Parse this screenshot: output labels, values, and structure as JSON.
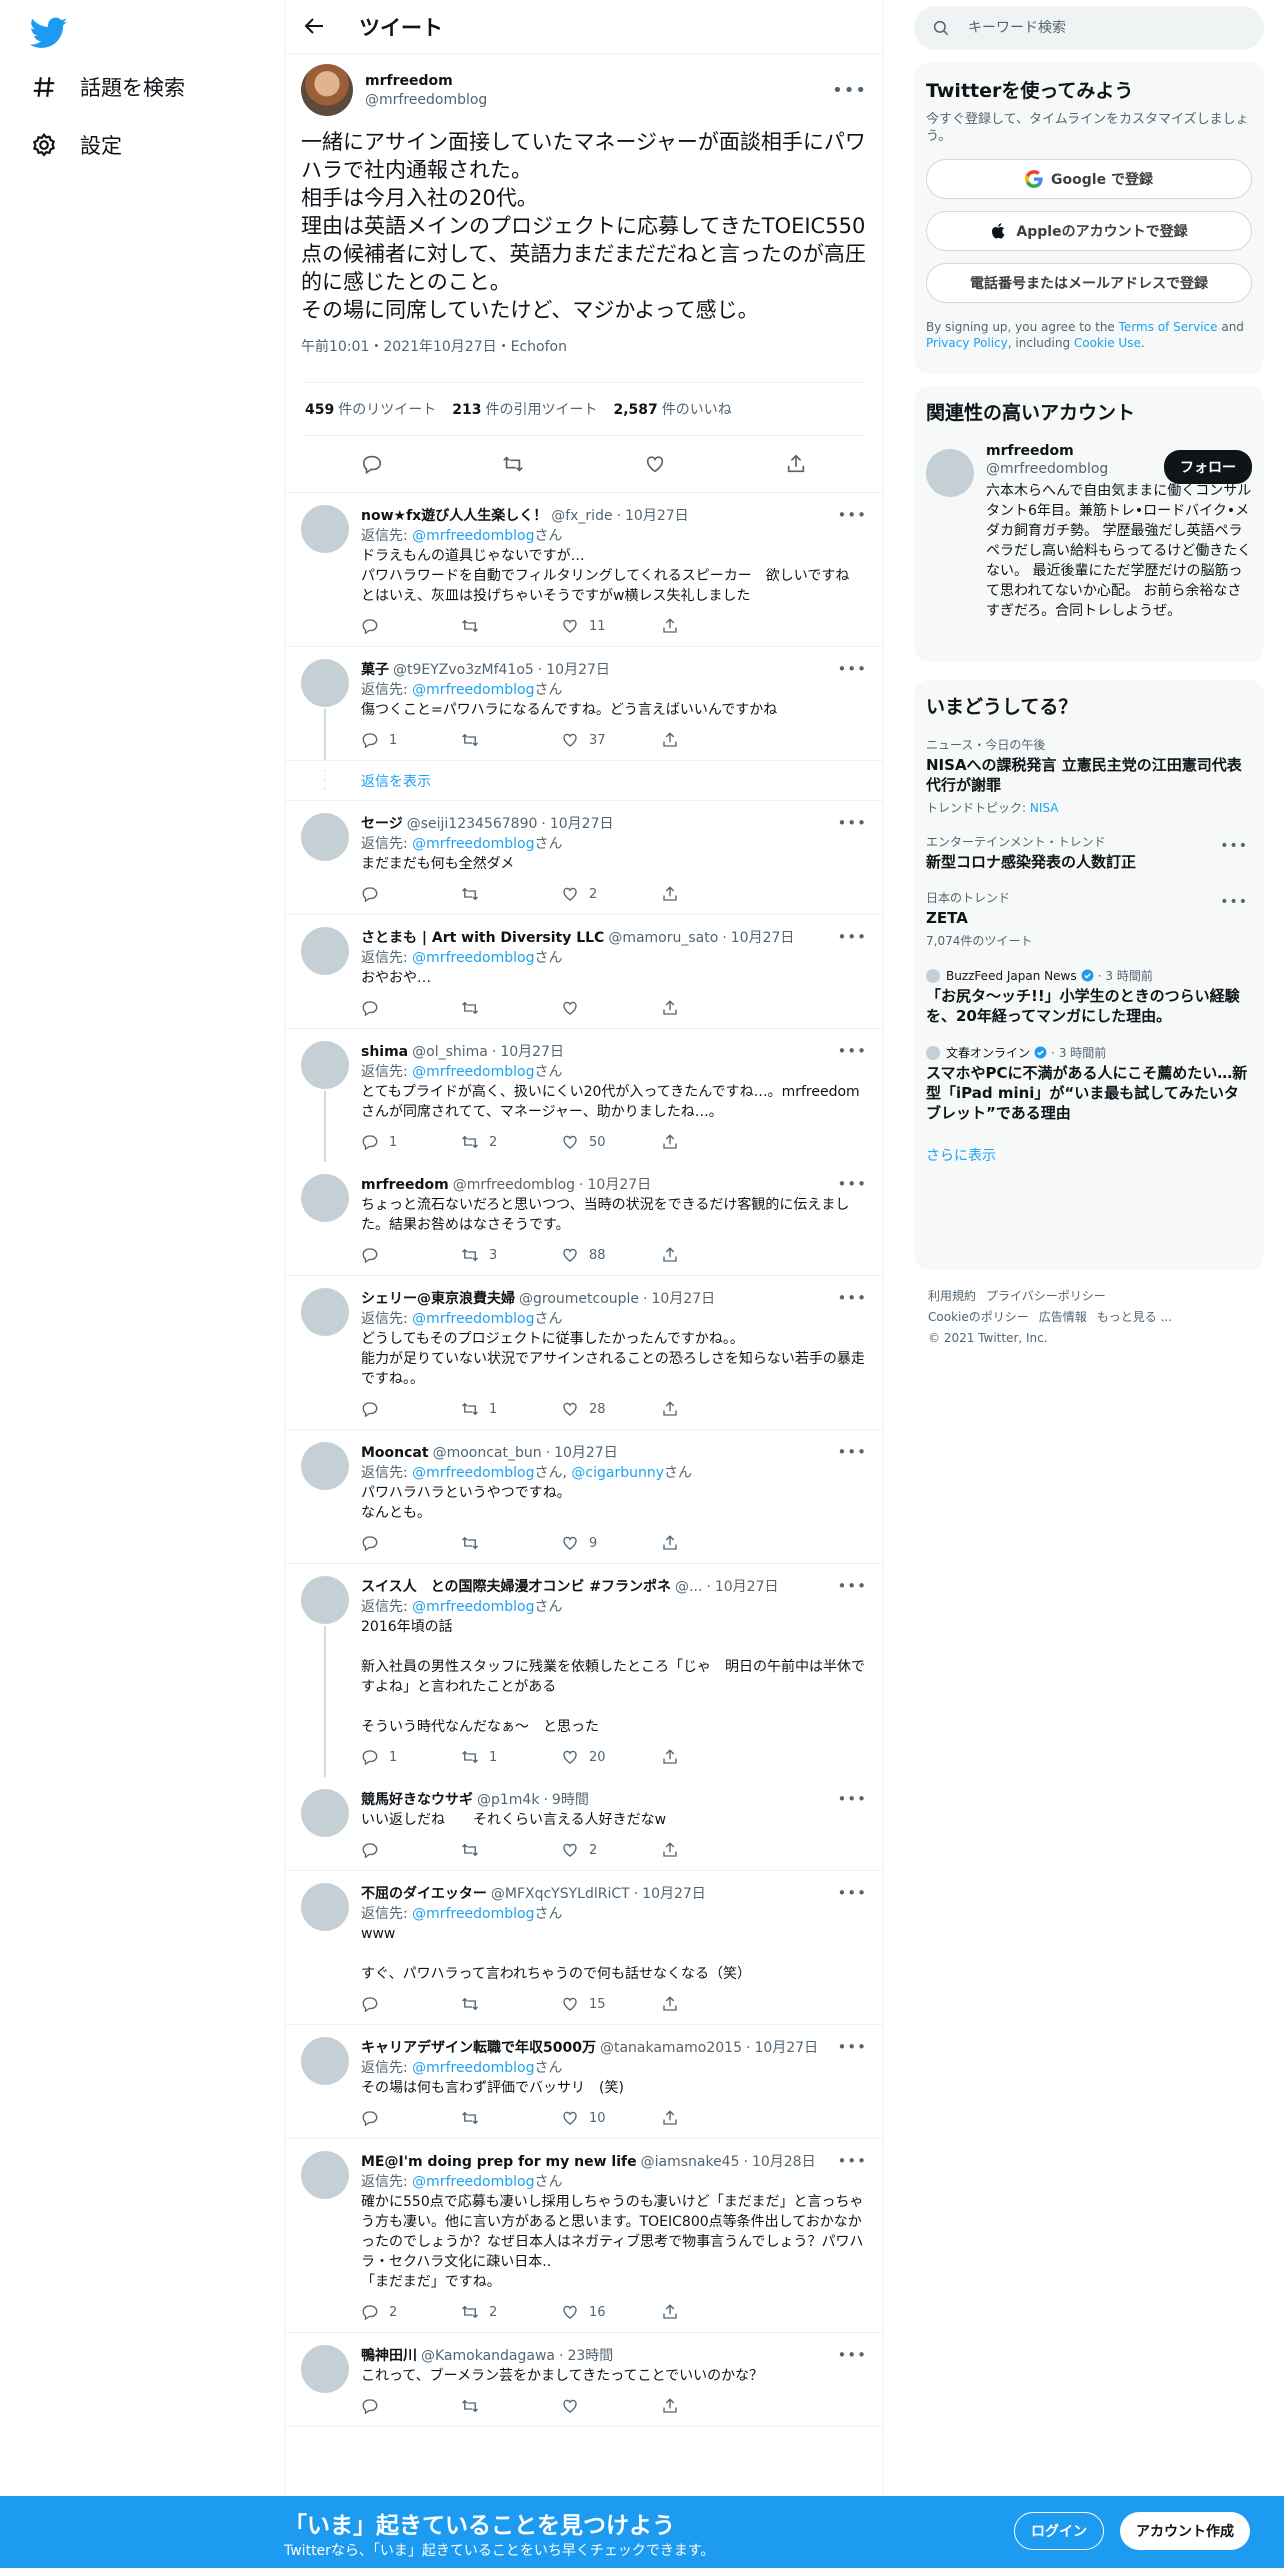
{
  "nav": {
    "explore_label": "話題を検索",
    "settings_label": "設定"
  },
  "header": {
    "title": "ツイート"
  },
  "focal": {
    "name": "mrfreedom",
    "handle": "@mrfreedomblog",
    "text": "一緒にアサイン面接していたマネージャーが面談相手にパワハラで社内通報された。\n相手は今月入社の20代。\n理由は英語メインのプロジェクトに応募してきたTOEIC550点の候補者に対して、英語力まだまだだねと言ったのが高圧的に感じたとのこと。\nその場に同席していたけど、マジかよって感じ。",
    "meta": "午前10:01・2021年10月27日・Echofon",
    "retweets": "459",
    "retweets_label": "件のリツイート",
    "quotes": "213",
    "quotes_label": "件の引用ツイート",
    "likes": "2,587",
    "likes_label": "件のいいね"
  },
  "replies": [
    {
      "name": "now★fx遊び人人生楽しく！",
      "handle": "@fx_ride",
      "date": "10月27日",
      "reply_prefix": "返信先: ",
      "reply_to": "@mrfreedomblog",
      "reply_suffix": "さん",
      "text": "ドラえもんの道具じゃないですが…\nパワハラワードを自動でフィルタリングしてくれるスピーカー　欲しいですね\nとはいえ、灰皿は投げちゃいそうですがw横レス失礼しました",
      "replies": "",
      "retweets": "",
      "likes": "11"
    },
    {
      "name": "菓子",
      "handle": "@t9EYZvo3zMf41o5",
      "date": "10月27日",
      "reply_prefix": "返信先: ",
      "reply_to": "@mrfreedomblog",
      "reply_suffix": "さん",
      "text": "傷つくこと=パワハラになるんですね。どう言えばいいんですかね",
      "replies": "1",
      "retweets": "",
      "likes": "37"
    },
    {
      "name": "セージ",
      "handle": "@seiji1234567890",
      "date": "10月27日",
      "reply_prefix": "返信先: ",
      "reply_to": "@mrfreedomblog",
      "reply_suffix": "さん",
      "text": "まだまだも何も全然ダメ",
      "replies": "",
      "retweets": "",
      "likes": "2"
    },
    {
      "name": "さとまも | Art with Diversity LLC",
      "handle": "@mamoru_sato",
      "date": "10月27日",
      "reply_prefix": "返信先: ",
      "reply_to": "@mrfreedomblog",
      "reply_suffix": "さん",
      "text": "おやおや…",
      "replies": "",
      "retweets": "",
      "likes": ""
    },
    {
      "name": "shima",
      "handle": "@ol_shima",
      "date": "10月27日",
      "reply_prefix": "返信先: ",
      "reply_to": "@mrfreedomblog",
      "reply_suffix": "さん",
      "text": "とてもプライドが高く、扱いにくい20代が入ってきたんですね…。mrfreedomさんが同席されてて、マネージャー、助かりましたね…。",
      "replies": "1",
      "retweets": "2",
      "likes": "50"
    },
    {
      "name": "mrfreedom",
      "handle": "@mrfreedomblog",
      "date": "10月27日",
      "reply_prefix": "",
      "reply_to": "",
      "reply_suffix": "",
      "text": "ちょっと流石ないだろと思いつつ、当時の状況をできるだけ客観的に伝えました。結果お咎めはなさそうです。",
      "replies": "",
      "retweets": "3",
      "likes": "88"
    },
    {
      "name": "シェリー@東京浪費夫婦",
      "handle": "@groumetcouple",
      "date": "10月27日",
      "reply_prefix": "返信先: ",
      "reply_to": "@mrfreedomblog",
      "reply_suffix": "さん",
      "text": "どうしてもそのプロジェクトに従事したかったんですかね。。\n能力が足りていない状況でアサインされることの恐ろしさを知らない若手の暴走ですね。。",
      "replies": "",
      "retweets": "1",
      "likes": "28"
    },
    {
      "name": "Mooncat",
      "handle": "@mooncat_bun",
      "date": "10月27日",
      "reply_prefix": "返信先: ",
      "reply_to": "@mrfreedomblog",
      "reply_to2": "@cigarbunny",
      "reply_suffix": "さん",
      "text": "パワハラハラというやつですね。\nなんとも。",
      "replies": "",
      "retweets": "",
      "likes": "9"
    },
    {
      "name": "スイス人　との国際夫婦漫才コンビ #フランポネ",
      "handle": "@...",
      "date": "10月27日",
      "reply_prefix": "返信先: ",
      "reply_to": "@mrfreedomblog",
      "reply_suffix": "さん",
      "text": "2016年頃の話\n\n新入社員の男性スタッフに残業を依頼したところ「じゃ　明日の午前中は半休ですよね」と言われたことがある\n\nそういう時代なんだなぁ〜　と思った",
      "replies": "1",
      "retweets": "1",
      "likes": "20"
    },
    {
      "name": "競馬好きなウサギ",
      "handle": "@p1m4k",
      "date": "9時間",
      "reply_prefix": "",
      "reply_to": "",
      "reply_suffix": "",
      "text": "いい返しだね　　それくらい言える人好きだなw",
      "replies": "",
      "retweets": "",
      "likes": "2"
    },
    {
      "name": "不屈のダイエッター",
      "handle": "@MFXqcYSYLdlRiCT",
      "date": "10月27日",
      "reply_prefix": "返信先: ",
      "reply_to": "@mrfreedomblog",
      "reply_suffix": "さん",
      "text": "www\n\nすぐ、パワハラって言われちゃうので何も話せなくなる（笑）",
      "replies": "",
      "retweets": "",
      "likes": "15"
    },
    {
      "name": "キャリアデザイン転職で年収5000万",
      "handle": "@tanakamamo2015",
      "date": "10月27日",
      "reply_prefix": "返信先: ",
      "reply_to": "@mrfreedomblog",
      "reply_suffix": "さん",
      "text": "その場は何も言わず評価でバッサリ　(笑)",
      "replies": "",
      "retweets": "",
      "likes": "10"
    },
    {
      "name": "ME@I'm doing prep for my new life",
      "handle": "@iamsnake45",
      "date": "10月28日",
      "reply_prefix": "返信先: ",
      "reply_to": "@mrfreedomblog",
      "reply_suffix": "さん",
      "text": "確かに550点で応募も凄いし採用しちゃうのも凄いけど「まだまだ」と言っちゃう方も凄い。他に言い方があると思います。TOEIC800点等条件出しておかなかったのでしょうか？なぜ日本人はネガティブ思考で物事言うんでしょう？パワハラ・セクハラ文化に疎い日本..\n「まだまだ」ですね。",
      "replies": "2",
      "retweets": "2",
      "likes": "16"
    },
    {
      "name": "鴨神田川",
      "handle": "@Kamokandagawa",
      "date": "23時間",
      "reply_prefix": "",
      "reply_to": "",
      "reply_suffix": "",
      "text": "これって、ブーメラン芸をかましてきたってことでいいのかな？",
      "replies": "",
      "retweets": "",
      "likes": ""
    }
  ],
  "show_replies_label": "返信を表示",
  "search": {
    "placeholder": "キーワード検索"
  },
  "signup": {
    "title": "Twitterを使ってみよう",
    "subtitle": "今すぐ登録して、タイムラインをカスタマイズしましょう。",
    "google": "Google で登録",
    "apple": "Appleのアカウントで登録",
    "phone": "電話番号またはメールアドレスで登録",
    "terms_pre": "By signing up, you agree to the ",
    "terms_link": "Terms of Service",
    "terms_mid": " and ",
    "privacy_link": "Privacy Policy",
    "terms_mid2": ", including ",
    "cookie_link": "Cookie Use",
    "terms_end": "."
  },
  "related": {
    "title": "関連性の高いアカウント",
    "name": "mrfreedom",
    "handle": "@mrfreedomblog",
    "follow": "フォロー",
    "bio": "六本木らへんで自由気ままに働くコンサルタント6年目。兼筋トレ•ロードバイク•メダカ飼育ガチ勢。 学歴最強だし英語ペラペラだし高い給料もらってるけど働きたくない。 最近後輩にただ学歴だけの脳筋って思われてないか心配。 お前ら余裕なさすぎだろ。合同トレしようぜ。"
  },
  "trends": {
    "title": "いまどうしてる？",
    "items": [
      {
        "context": "ニュース・今日の午後",
        "title": "NISAへの課税発言 立憲民主党の江田憲司代表代行が謝罪",
        "topic_label": "トレンドトピック: ",
        "topic": "NISA"
      },
      {
        "context": "エンターテインメント・トレンド",
        "title": "新型コロナ感染発表の人数訂正"
      },
      {
        "context": "日本のトレンド",
        "title": "ZETA",
        "count": "7,074件のツイート"
      }
    ],
    "news": [
      {
        "source": "BuzzFeed Japan News",
        "time": "3 時間前",
        "title": "「お尻タ〜ッチ!!」小学生のときのつらい経験を、20年経ってマンガにした理由。"
      },
      {
        "source": "文春オンライン",
        "time": "3 時間前",
        "title": "スマホやPCに不満がある人にこそ薦めたい…新型「iPad mini」が“いま最も試してみたいタブレット”である理由"
      }
    ],
    "show_more": "さらに表示"
  },
  "footer": {
    "terms": "利用規約",
    "privacy": "プライバシーポリシー",
    "cookie": "Cookieのポリシー",
    "ads": "広告情報",
    "more": "もっと見る ...",
    "copyright": "© 2021 Twitter, Inc."
  },
  "bottombar": {
    "title": "「いま」起きていることを見つけよう",
    "subtitle": "Twitterなら、「いま」起きていることをいち早くチェックできます。",
    "login": "ログイン",
    "signup": "アカウント作成"
  },
  "colors": {
    "accent": "#1d9bf0",
    "link": "#1da1f2",
    "text": "#0f1419",
    "muted": "#536471"
  }
}
